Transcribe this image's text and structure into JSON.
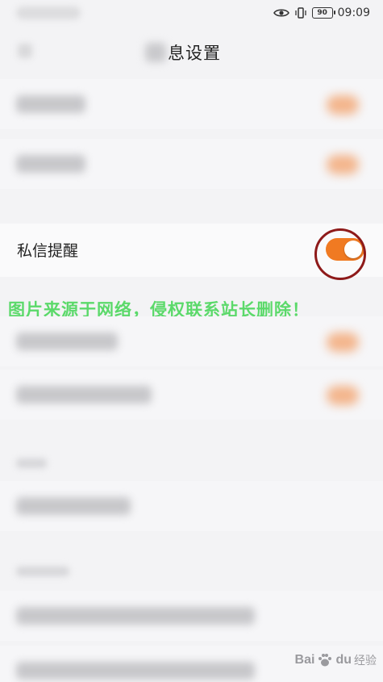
{
  "status_bar": {
    "battery": "90",
    "time": "09:09",
    "icons": [
      "eye-icon",
      "vibrate-icon",
      "battery-icon"
    ]
  },
  "header": {
    "title_visible": "息设置"
  },
  "focused_setting": {
    "label": "私信提醒",
    "toggle_on": true,
    "toggle_color": "#f07a22",
    "highlight_color": "#8e1a1a"
  },
  "watermark": {
    "text": "图片来源于网络，侵权联系站长删除！",
    "color": "#5bd96a"
  },
  "logo": {
    "brand": "Bai",
    "suffix": "du",
    "sub": "经验"
  }
}
